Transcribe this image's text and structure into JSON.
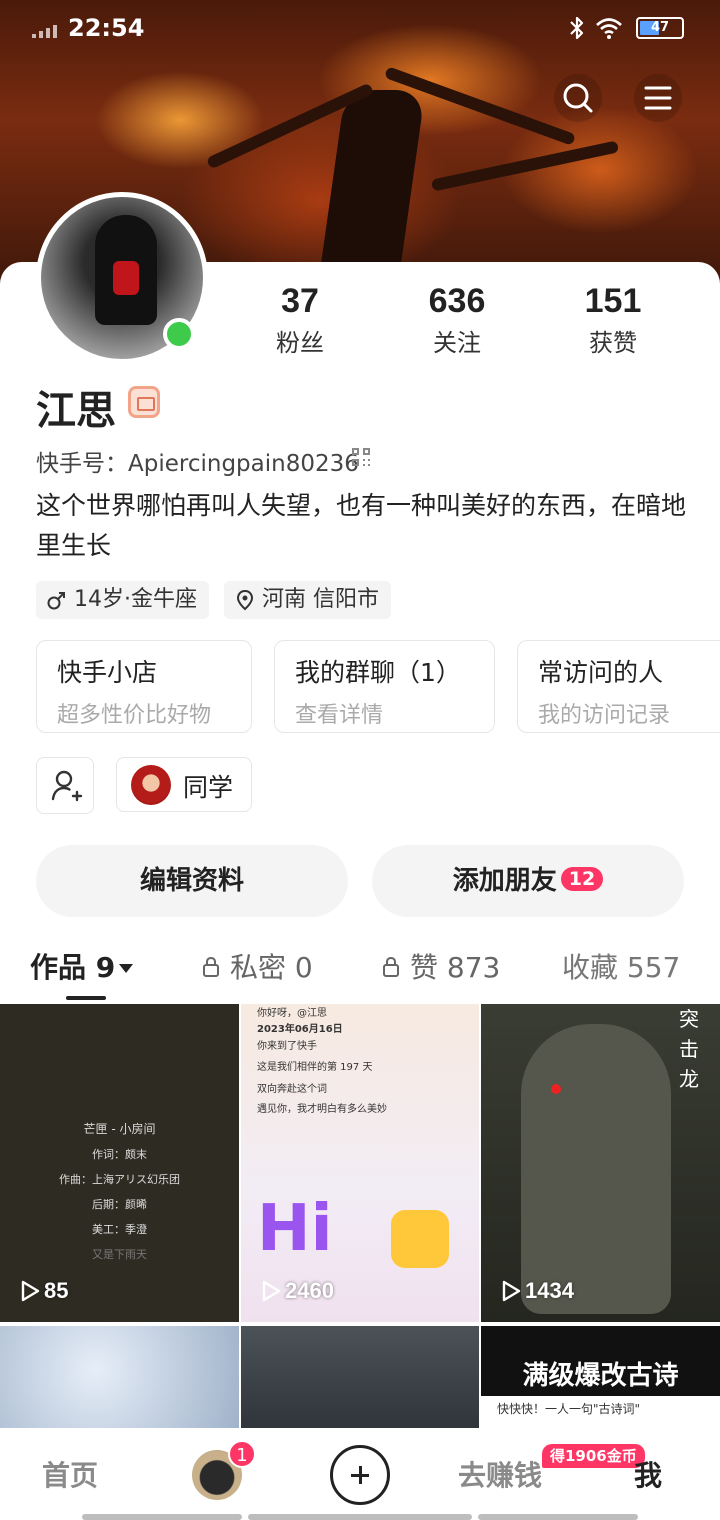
{
  "status_bar": {
    "time": "22:54",
    "battery": "47",
    "battery_level": 0.47
  },
  "profile": {
    "name": "江思",
    "kuaishou_id": "快手号：Apiercingpain80236",
    "bio": "这个世界哪怕再叫人失望，也有一种叫美好的东西，在暗地里生长",
    "tags": [
      "14岁·金牛座",
      "河南 信阳市"
    ],
    "online": true
  },
  "stats": [
    {
      "num": "37",
      "label": "粉丝"
    },
    {
      "num": "636",
      "label": "关注"
    },
    {
      "num": "151",
      "label": "获赞"
    }
  ],
  "services": [
    {
      "title": "快手小店",
      "subtitle": "超多性价比好物"
    },
    {
      "title": "我的群聊（1）",
      "subtitle": "查看详情"
    },
    {
      "title": "常访问的人",
      "subtitle": "我的访问记录"
    }
  ],
  "chip": {
    "label": "同学"
  },
  "actions": {
    "edit": "编辑资料",
    "add_friend": "添加朋友",
    "add_friend_badge": "12"
  },
  "tabs": [
    {
      "label": "作品 9",
      "active": true
    },
    {
      "label": "私密 0"
    },
    {
      "label": "赞 873"
    },
    {
      "label": "收藏 557"
    }
  ],
  "videos": [
    {
      "plays": "85",
      "lyrics": [
        "芒匣 - 小房间",
        "作词：颇末",
        "作曲：上海アリス幻乐团",
        "后期：颜晞",
        "美工：季澄",
        "又是下雨天"
      ]
    },
    {
      "plays": "2460",
      "lines": [
        "你好呀，@江思",
        "2023年06月16日",
        "你来到了快手",
        "这是我们相伴的第 197 天",
        "双向奔赴这个词",
        "遇见你，我才明白有多么美妙"
      ],
      "big_text": "Hi"
    },
    {
      "plays": "1434",
      "vertical_text": "突击龙"
    },
    {},
    {},
    {
      "title": "满级爆改古诗",
      "subtitle": "快快快！一人一句\"古诗词\""
    }
  ],
  "bottom_nav": {
    "home": "首页",
    "avatar_badge": "1",
    "earn": "去赚钱",
    "coin_badge": "得1906金币",
    "me": "我"
  },
  "colors": {
    "accent_red": "#fe3666",
    "online_green": "#3ecb4c"
  }
}
